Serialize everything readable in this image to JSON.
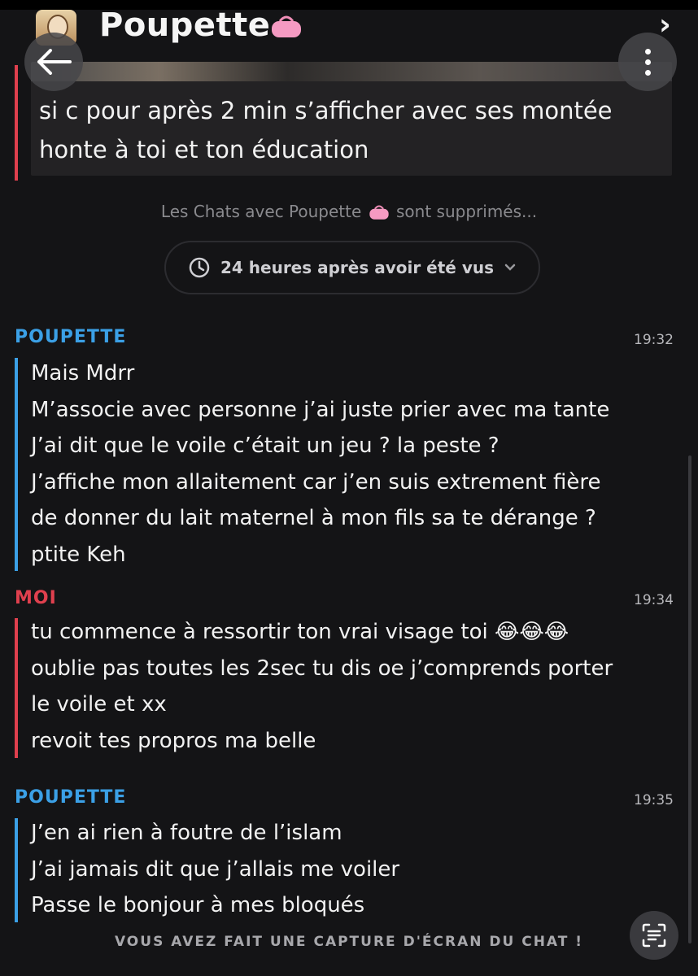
{
  "header": {
    "title": "Poupette",
    "back_icon": "arrow-left-icon",
    "more_icon": "vertical-dots-icon",
    "chevron_icon": "chevron-right-icon"
  },
  "quoted_reply": {
    "text_line1": "si c pour après 2 min s’afficher avec ses montée",
    "text_line2": "honte à toi et ton éducation"
  },
  "info": {
    "prefix": "Les Chats avec Poupette",
    "suffix": "sont supprimés...",
    "timer_label": "24 heures après avoir été vus"
  },
  "messages": [
    {
      "sender": "POUPETTE",
      "time": "19:32",
      "lines": [
        "Mais Mdrr",
        "M’associe avec personne j’ai juste prier avec ma tante",
        "J’ai dit que le voile c’était un jeu ? la peste ?",
        "J’affiche mon allaitement car j’en suis extrement fière",
        "de donner du lait maternel à mon fils sa te dérange ?",
        "ptite Keh"
      ]
    },
    {
      "sender": "MOI",
      "time": "19:34",
      "lines": [
        "tu commence à ressortir ton vrai visage toi",
        "oublie pas toutes les 2sec tu dis oe j’comprends porter",
        "le voile et xx",
        "revoit tes propros ma belle"
      ],
      "emoji": "😂😂😂"
    },
    {
      "sender": "POUPETTE",
      "time": "19:35",
      "lines": [
        "J’en ai rien à foutre de l’islam",
        "J’ai jamais dit que j’allais me voiler",
        "Passe le bonjour à mes bloqués"
      ]
    }
  ],
  "footer": {
    "screenshot_notice": "VOUS AVEZ FAIT UNE CAPTURE D'ÉCRAN DU CHAT !"
  },
  "colors": {
    "background": "#141416",
    "friend": "#3ba0e6",
    "me": "#e0404e"
  }
}
